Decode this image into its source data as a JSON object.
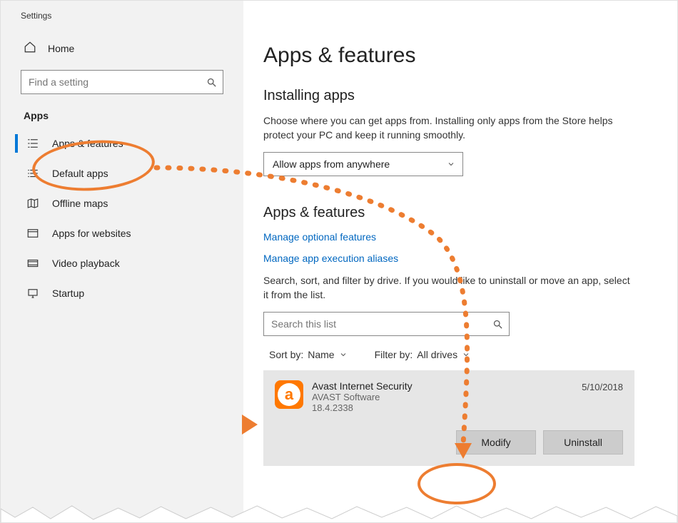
{
  "window_title": "Settings",
  "home_label": "Home",
  "search_placeholder": "Find a setting",
  "section_label": "Apps",
  "nav": [
    {
      "label": "Apps & features"
    },
    {
      "label": "Default apps"
    },
    {
      "label": "Offline maps"
    },
    {
      "label": "Apps for websites"
    },
    {
      "label": "Video playback"
    },
    {
      "label": "Startup"
    }
  ],
  "main": {
    "heading": "Apps & features",
    "installing_heading": "Installing apps",
    "installing_para": "Choose where you can get apps from. Installing only apps from the Store helps protect your PC and keep it running smoothly.",
    "source_select": "Allow apps from anywhere",
    "subheading": "Apps & features",
    "link1": "Manage optional features",
    "link2": "Manage app execution aliases",
    "list_para": "Search, sort, and filter by drive. If you would like to uninstall or move an app, select it from the list.",
    "list_search_placeholder": "Search this list",
    "sort_by_label": "Sort by:",
    "sort_by_value": "Name",
    "filter_by_label": "Filter by:",
    "filter_by_value": "All drives",
    "app": {
      "name": "Avast Internet Security",
      "publisher": "AVAST Software",
      "version": "18.4.2338",
      "date": "5/10/2018",
      "modify": "Modify",
      "uninstall": "Uninstall"
    }
  }
}
